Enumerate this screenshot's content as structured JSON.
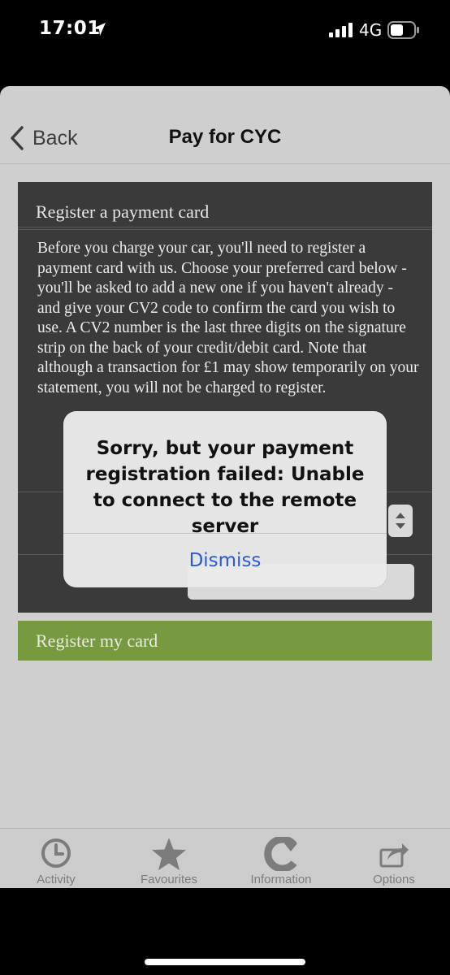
{
  "status_bar": {
    "time": "17:01",
    "network": "4G"
  },
  "nav": {
    "back_label": "Back",
    "title": "Pay for CYC"
  },
  "panel": {
    "title": "Register a payment card",
    "body": "Before you charge your car, you'll need to register a payment card with us. Choose your preferred card below - you'll be asked to add a new one if you haven't already - and give your CV2 code to confirm the card you wish to use. A CV2 number is the last three digits on the signature strip on the back of your credit/debit card. Note that although a transaction for £1 may show temporarily on your statement, you will not be charged to register."
  },
  "register_button": {
    "label": "Register my card"
  },
  "alert": {
    "message": "Sorry, but your payment registration failed: Unable to connect to the remote server",
    "dismiss_label": "Dismiss"
  },
  "tabs": [
    {
      "label": "Activity",
      "icon": "clock-icon"
    },
    {
      "label": "Favourites",
      "icon": "star-icon"
    },
    {
      "label": "Information",
      "icon": "information-logo-icon"
    },
    {
      "label": "Options",
      "icon": "share-icon"
    }
  ],
  "colors": {
    "accent_green": "#77993f",
    "panel_dark": "#3b3a3b",
    "alert_link": "#2a5ad6"
  }
}
